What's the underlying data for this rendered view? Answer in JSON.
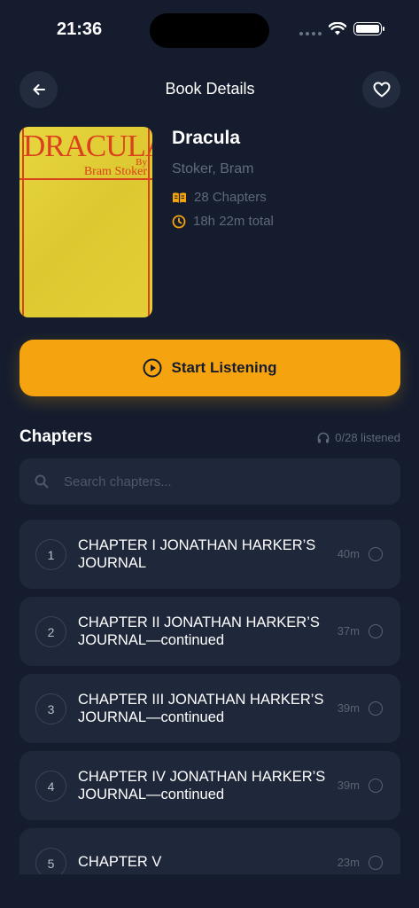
{
  "status_bar": {
    "time": "21:36"
  },
  "header": {
    "title": "Book Details"
  },
  "book": {
    "title": "Dracula",
    "author": "Stoker, Bram",
    "chapters_count": "28 Chapters",
    "total_duration": "18h 22m total",
    "cover": {
      "title": "DRACULA",
      "by": "By",
      "author": "Bram Stoker"
    }
  },
  "start_button": {
    "label": "Start Listening"
  },
  "chapters_section": {
    "title": "Chapters",
    "listened": "0/28 listened",
    "search_placeholder": "Search chapters..."
  },
  "chapters": [
    {
      "number": "1",
      "title": "CHAPTER I JONATHAN HARKER’S JOURNAL",
      "duration": "40m"
    },
    {
      "number": "2",
      "title": "CHAPTER II JONATHAN HARKER’S JOURNAL—continued",
      "duration": "37m"
    },
    {
      "number": "3",
      "title": "CHAPTER III JONATHAN HARKER’S JOURNAL—continued",
      "duration": "39m"
    },
    {
      "number": "4",
      "title": "CHAPTER IV JONATHAN HARKER’S JOURNAL—continued",
      "duration": "39m"
    },
    {
      "number": "5",
      "title": "CHAPTER V",
      "duration": "23m"
    }
  ],
  "colors": {
    "background": "#141c2e",
    "card": "#1f283a",
    "accent": "#f5a30f",
    "muted_text": "#5f6878"
  },
  "icons": [
    "back-arrow-icon",
    "heart-icon",
    "book-icon",
    "clock-icon",
    "play-circle-icon",
    "headphones-icon",
    "search-icon",
    "radio-empty-icon",
    "wifi-icon",
    "battery-icon",
    "signal-icon"
  ]
}
